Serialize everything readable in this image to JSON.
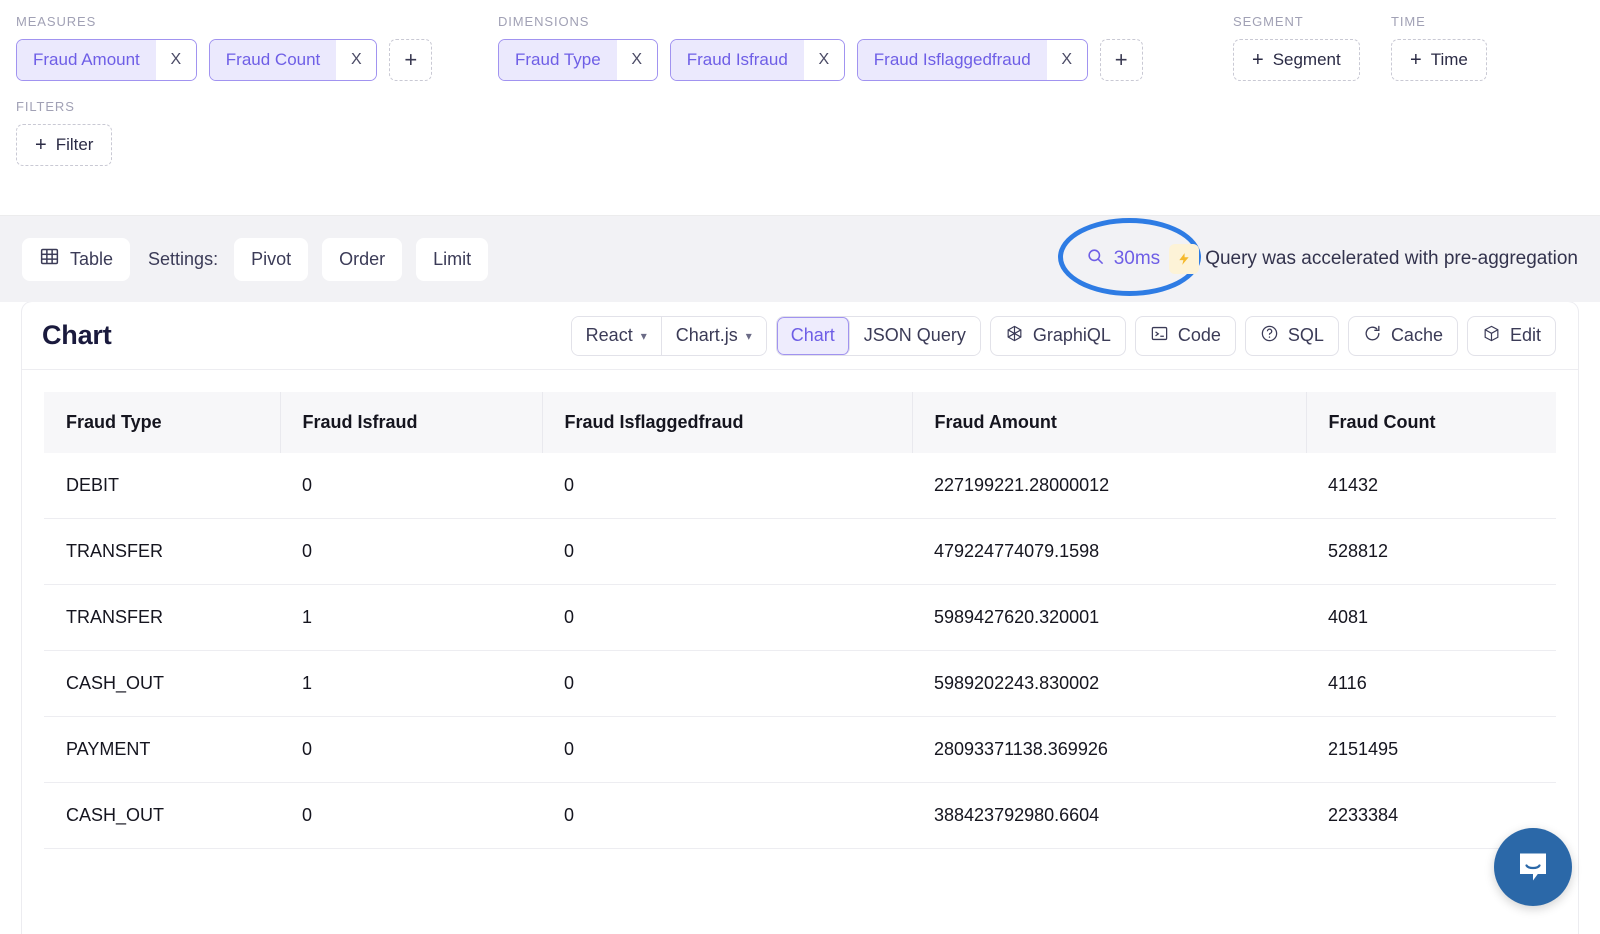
{
  "builder": {
    "measures": {
      "label": "MEASURES",
      "chips": [
        {
          "label": "Fraud Amount",
          "remove": "X"
        },
        {
          "label": "Fraud Count",
          "remove": "X"
        }
      ],
      "add": "+"
    },
    "dimensions": {
      "label": "DIMENSIONS",
      "chips": [
        {
          "label": "Fraud Type",
          "remove": "X"
        },
        {
          "label": "Fraud Isfraud",
          "remove": "X"
        },
        {
          "label": "Fraud Isflaggedfraud",
          "remove": "X"
        }
      ],
      "add": "+"
    },
    "segment": {
      "label": "SEGMENT",
      "add": "Segment",
      "plus": "+"
    },
    "time": {
      "label": "TIME",
      "add": "Time",
      "plus": "+"
    },
    "filters": {
      "label": "FILTERS",
      "add": "Filter",
      "plus": "+"
    }
  },
  "strip": {
    "table_button": "Table",
    "settings_label": "Settings:",
    "settings": [
      "Pivot",
      "Order",
      "Limit"
    ],
    "timing": "30ms",
    "search_icon": "search-icon",
    "lightning_icon": "lightning-icon",
    "accelerated_text": "Query was accelerated with pre-aggregation",
    "annotation_color": "#2e7ce4"
  },
  "card": {
    "title": "Chart",
    "framework_select": "React",
    "library_select": "Chart.js",
    "view_tabs": [
      "Chart",
      "JSON Query"
    ],
    "active_view": "Chart",
    "tools": [
      {
        "label": "GraphiQL",
        "icon": "graphiql-icon"
      },
      {
        "label": "Code",
        "icon": "terminal-icon"
      },
      {
        "label": "SQL",
        "icon": "question-circle-icon"
      },
      {
        "label": "Cache",
        "icon": "refresh-icon"
      },
      {
        "label": "Edit",
        "icon": "cube-icon"
      }
    ]
  },
  "table": {
    "columns": [
      "Fraud Type",
      "Fraud Isfraud",
      "Fraud Isflaggedfraud",
      "Fraud Amount",
      "Fraud Count"
    ],
    "rows": [
      [
        "DEBIT",
        "0",
        "0",
        "227199221.28000012",
        "41432"
      ],
      [
        "TRANSFER",
        "0",
        "0",
        "479224774079.1598",
        "528812"
      ],
      [
        "TRANSFER",
        "1",
        "0",
        "5989427620.320001",
        "4081"
      ],
      [
        "CASH_OUT",
        "1",
        "0",
        "5989202243.830002",
        "4116"
      ],
      [
        "PAYMENT",
        "0",
        "0",
        "28093371138.369926",
        "2151495"
      ],
      [
        "CASH_OUT",
        "0",
        "0",
        "388423792980.6604",
        "2233384"
      ]
    ]
  },
  "intercom": {
    "name": "intercom-launcher"
  },
  "colors": {
    "accent_purple": "#6e5ee6",
    "chip_bg": "#ebe9fd",
    "annotation_blue": "#2e7ce4",
    "intercom_blue": "#2b68a8",
    "lightning_yellow": "#f5b92b"
  }
}
